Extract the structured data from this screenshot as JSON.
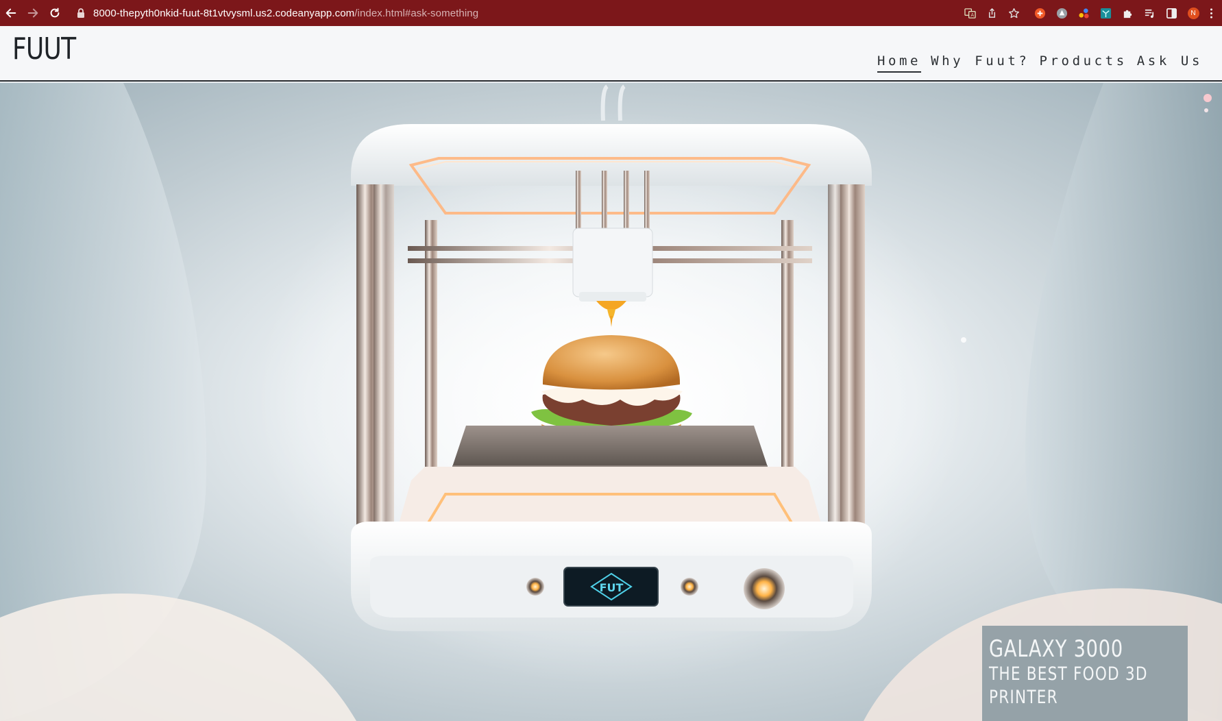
{
  "browser": {
    "url_host": "8000-thepyth0nkid-fuut-8t1vtvysml.us2.codeanyapp.com",
    "url_path": "/index.html#ask-something",
    "profile_initial": "N"
  },
  "site": {
    "logo": "FUUT",
    "nav": [
      {
        "label": "Home",
        "active": true
      },
      {
        "label": "Why Fuut?",
        "active": false
      },
      {
        "label": "Products",
        "active": false
      },
      {
        "label": "Ask Us",
        "active": false
      }
    ]
  },
  "hero": {
    "image_subject": "3D food printer printing a burger",
    "display_logo": "FUT",
    "caption_title": "GALAXY 3000",
    "caption_line1": "THE BEST FOOD 3D",
    "caption_line2": "PRINTER"
  }
}
